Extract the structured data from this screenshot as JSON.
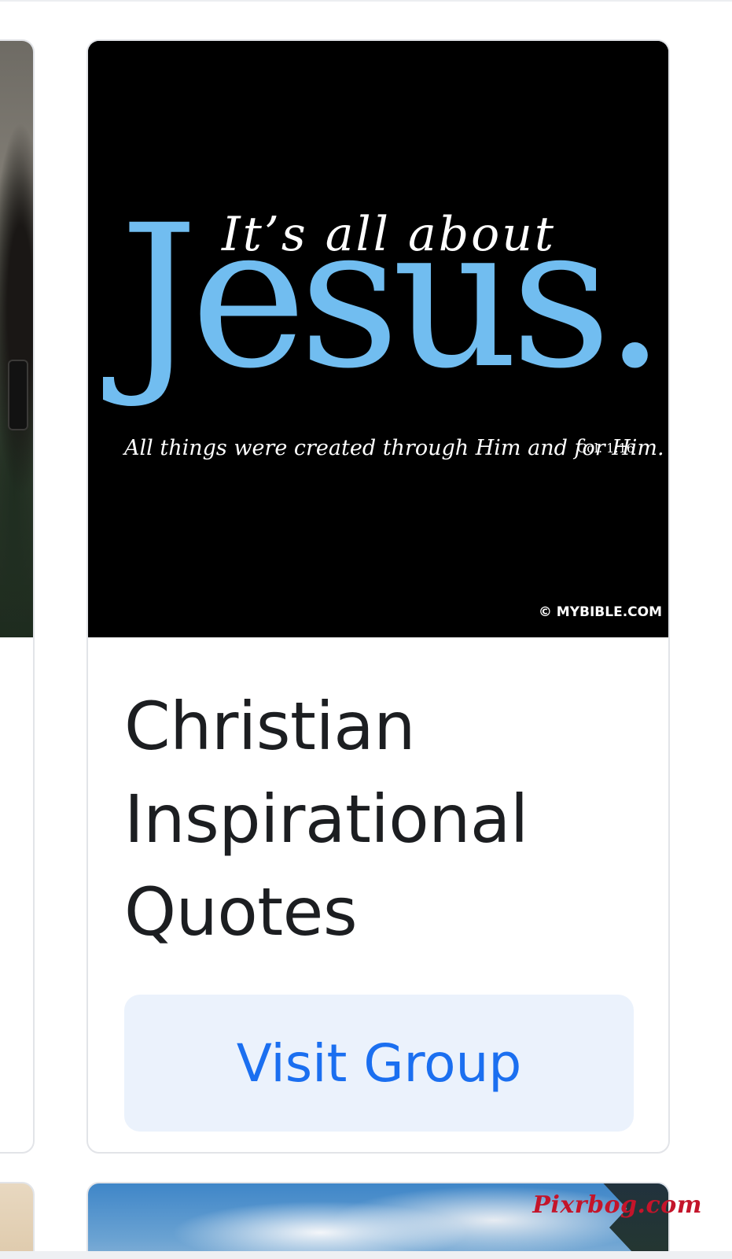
{
  "group_card": {
    "image": {
      "headline_small": "It’s all about",
      "headline_large": "Jesus.",
      "verse_text": "All things were created through Him and for Him.",
      "verse_ref": "Col. 1:16",
      "copyright": "© MYBIBLE.COM",
      "text_color": "#ffffff",
      "accent_color": "#71bdf0",
      "background_color": "#000000"
    },
    "title": "Christian Inspirational Quotes",
    "button_label": "Visit Group",
    "button_color": "#1b6ff0",
    "button_background": "#ebf2fc"
  },
  "watermark": "Pixrbog.com"
}
